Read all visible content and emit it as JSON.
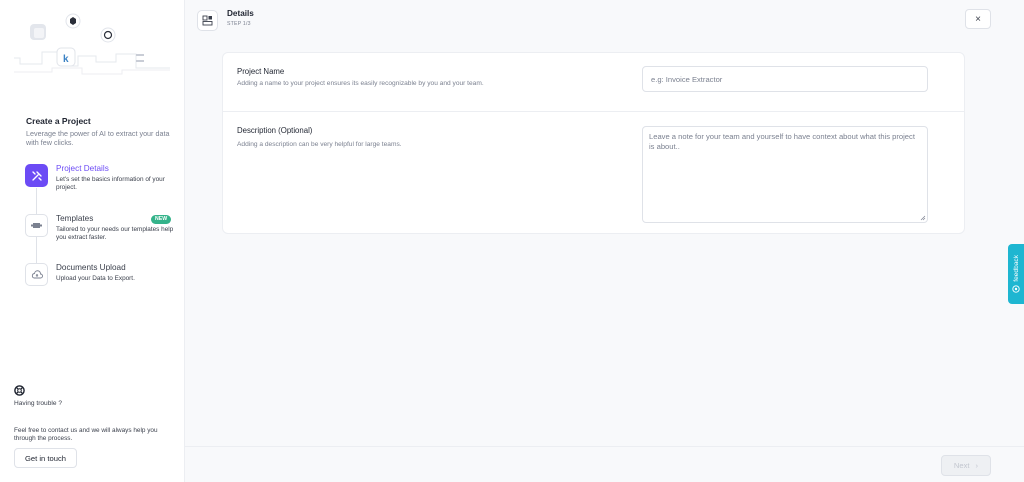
{
  "sidebar": {
    "illustration_letter": "k",
    "create_title": "Create a Project",
    "create_desc": "Leverage the power of AI to extract your data with few clicks.",
    "steps": [
      {
        "title": "Project Details",
        "desc": "Let's set the basics information of your project.",
        "icon": "wand-tools-icon",
        "active": true
      },
      {
        "title": "Templates",
        "desc": "Tailored to your needs our templates help you extract faster.",
        "icon": "template-icon",
        "badge": "NEW"
      },
      {
        "title": "Documents Upload",
        "desc": "Upload your Data to Export.",
        "icon": "cloud-upload-icon"
      }
    ],
    "trouble": "Having trouble ?",
    "contact": "Feel free to contact us and we will always help you through the process.",
    "get_in_touch": "Get in touch"
  },
  "header": {
    "title": "Details",
    "step": "STEP 1/3",
    "close": "×"
  },
  "form": {
    "name_label": "Project Name",
    "name_help": "Adding a name to your project ensures its easily recognizable by you and your team.",
    "name_placeholder": "e.g: Invoice Extractor",
    "name_value": "",
    "desc_label": "Description (Optional)",
    "desc_help": "Adding a description can be very helpful for large teams.",
    "desc_placeholder": "Leave a note for your team and yourself to have context about what this project is about..",
    "desc_value": ""
  },
  "footer": {
    "next": "Next",
    "next_arrow": "›"
  },
  "feedback": "feedback",
  "colors": {
    "accent": "#6c4bf5",
    "badge": "#34b38a",
    "feedback": "#1eb6d1",
    "page_bg": "#f8f9fb"
  }
}
